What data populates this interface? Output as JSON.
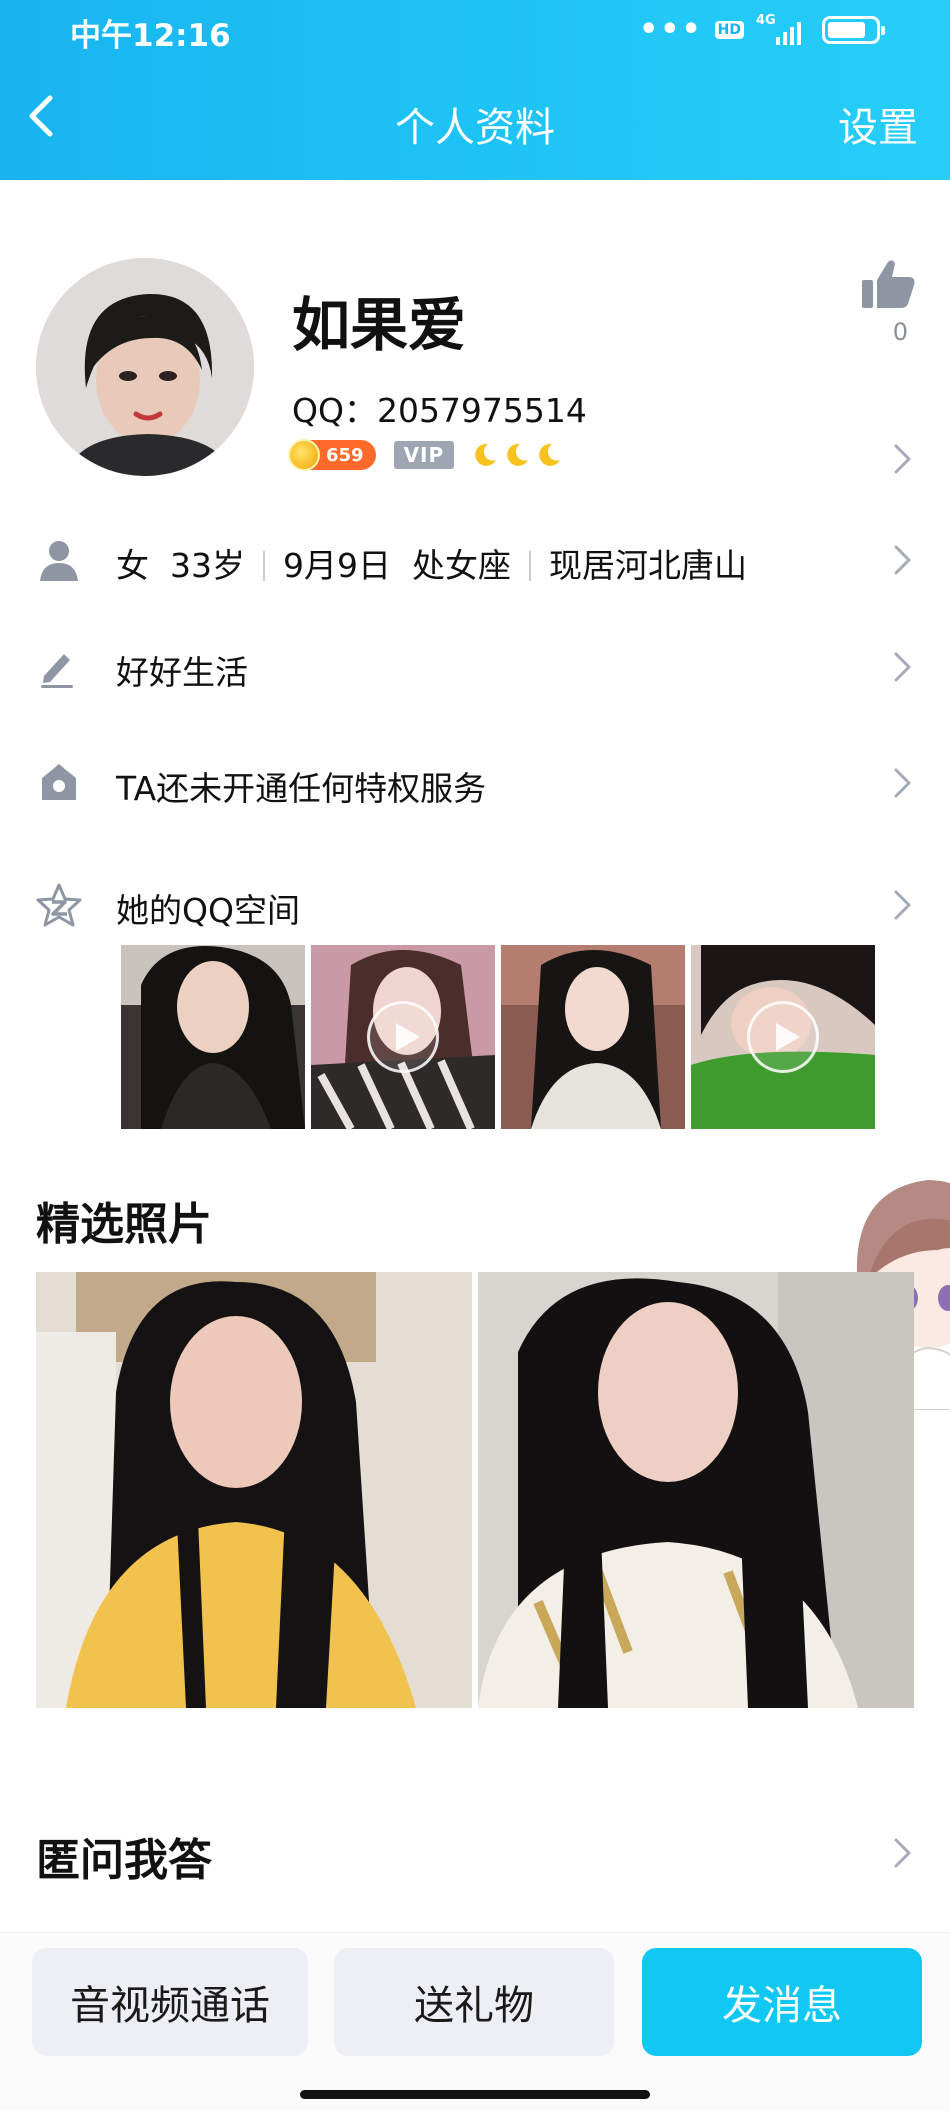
{
  "status_bar": {
    "time": "中午12:16",
    "dots": "•••",
    "hd": "HD",
    "network": "4G",
    "battery_level": 0.8
  },
  "nav": {
    "title": "个人资料",
    "settings": "设置"
  },
  "profile": {
    "name": "如果爱",
    "qq": "QQ：2057975514",
    "coin_level": "659",
    "vip": "VIP",
    "likes": "0"
  },
  "basic_info": {
    "gender": "女",
    "age": "33岁",
    "birthday": "9月9日",
    "zodiac": "处女座",
    "location": "现居河北唐山"
  },
  "signature": "好好生活",
  "privilege": "TA还未开通任何特权服务",
  "qzone": {
    "label": "她的QQ空间"
  },
  "sections": {
    "featured_photos": "精选照片",
    "anon_qa": "匿问我答"
  },
  "actions": {
    "call": "音视频通话",
    "gift": "送礼物",
    "message": "发消息"
  },
  "colors": {
    "header_start": "#19b4f0",
    "header_end": "#27cef8",
    "primary_button": "#11c8f2",
    "icon_gray": "#8f96a3"
  },
  "icons": [
    "back-chevron-icon",
    "thumbs-up-icon",
    "person-icon",
    "pen-icon",
    "crown-icon",
    "qzone-star-icon",
    "chevron-right-icon",
    "play-icon",
    "coin-icon",
    "moon-icon"
  ]
}
